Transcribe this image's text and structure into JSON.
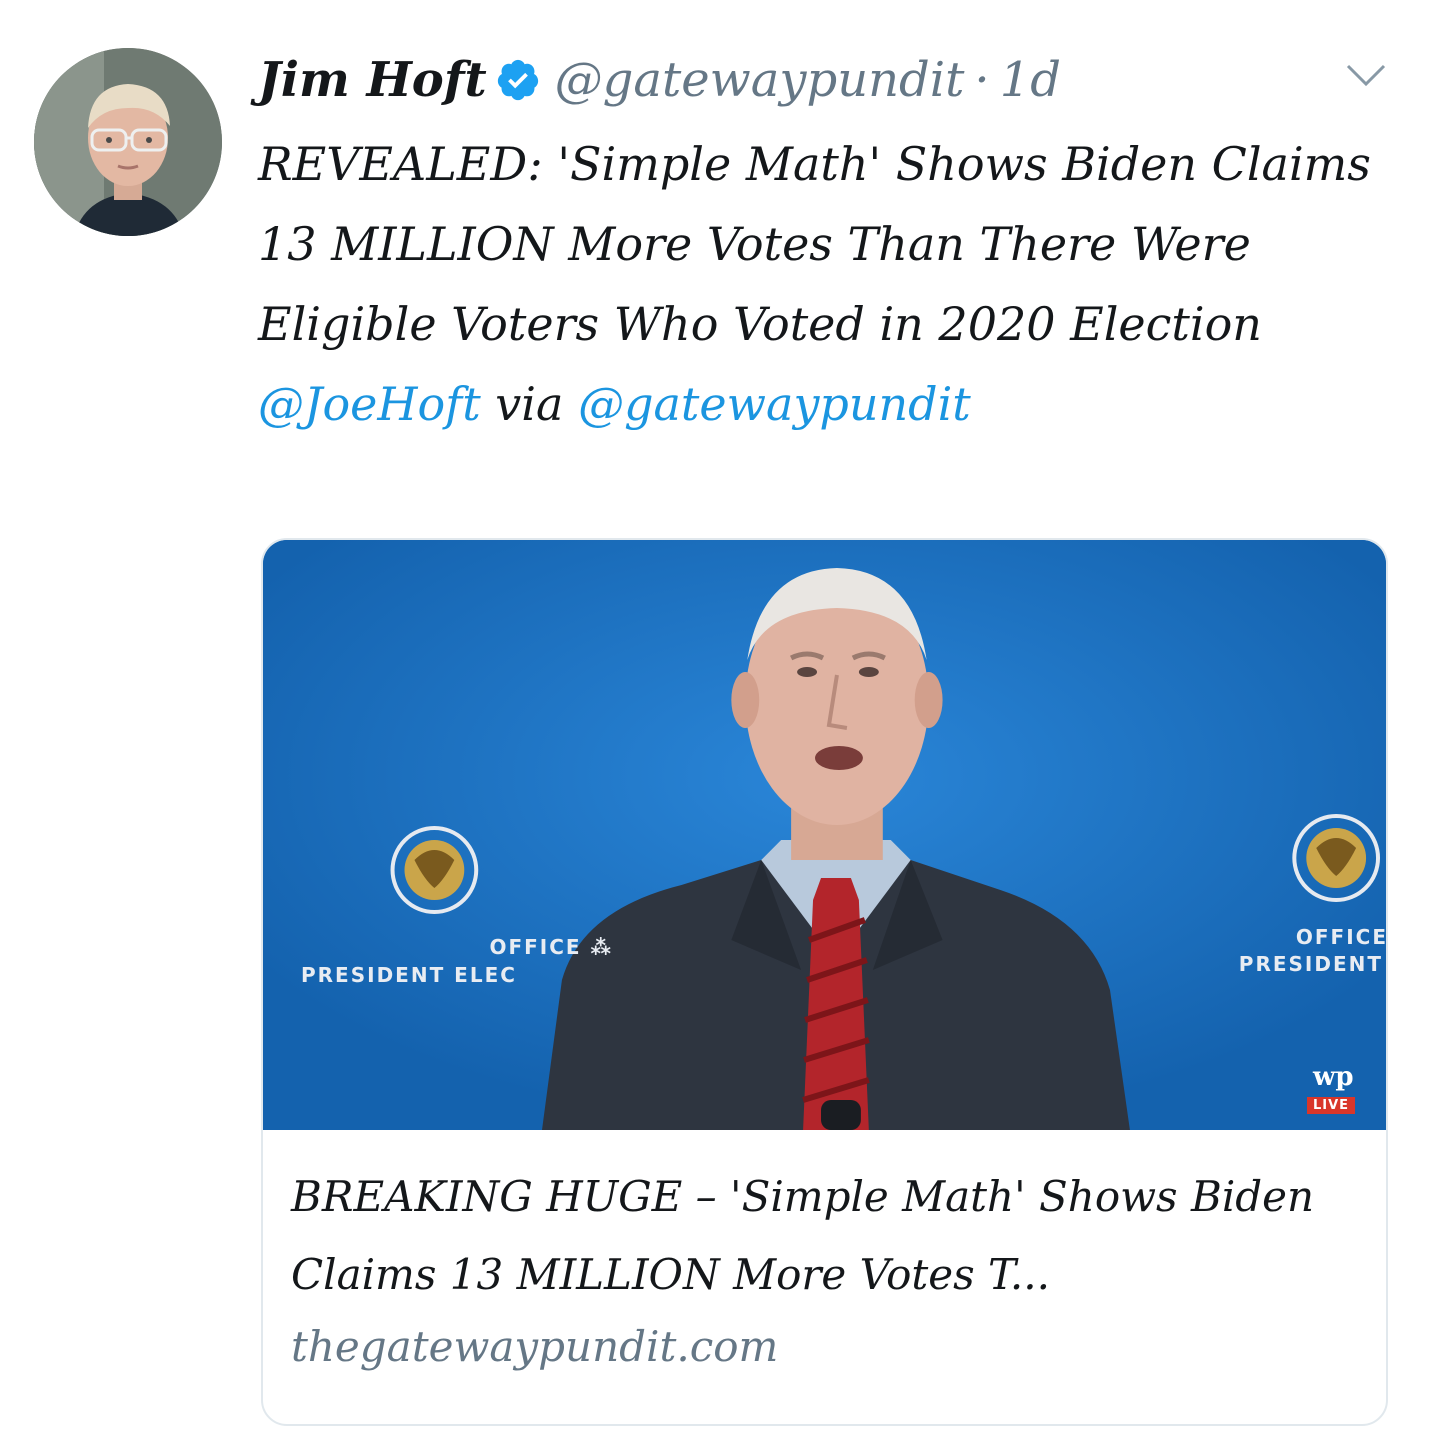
{
  "tweet": {
    "display_name": "Jim Hoft",
    "handle": "@gatewaypundit",
    "separator": "·",
    "time": "1d",
    "text_before_mention": "REVEALED: 'Simple Math' Shows Biden Claims 13 MILLION More Votes Than There Were Eligible Voters Who Voted in 2020 Election ",
    "mention_1": "@JoeHoft",
    "text_between": " via ",
    "mention_2": "@gatewaypundit"
  },
  "card": {
    "image": {
      "seal_left_office": "OFFICE ⁂",
      "seal_left_president": "PRESIDENT ELEC",
      "seal_right_office": "OFFICE",
      "seal_right_president": "PRESIDENT",
      "wp_logo": "wp",
      "live_badge": "LIVE"
    },
    "title": "BREAKING HUGE – 'Simple Math' Shows Biden Claims 13 MILLION More Votes T...",
    "domain": "thegatewaypundit.com"
  },
  "colors": {
    "link": "#1b95e0",
    "secondary_text": "#657786",
    "card_border": "#e1e8ed",
    "image_background": "#1a6fc2"
  },
  "icons": {
    "verified": "verified-badge-icon",
    "menu": "chevron-down-icon"
  }
}
